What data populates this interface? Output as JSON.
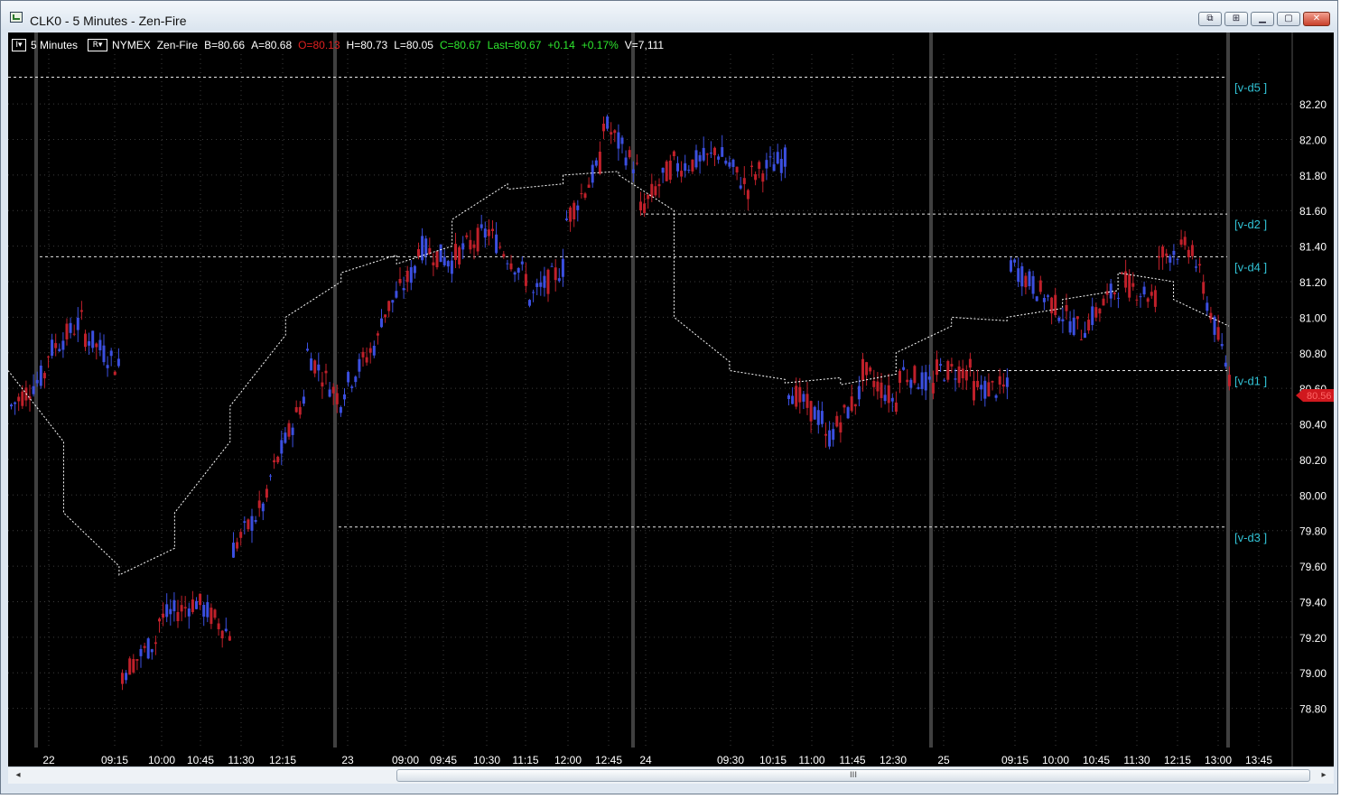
{
  "window": {
    "title": "CLK0 - 5 Minutes - Zen-Fire",
    "buttons": [
      "restore-down",
      "pin",
      "minimize",
      "maximize",
      "close"
    ]
  },
  "infobar": {
    "interval_btn": "I▾",
    "interval": "5 Minutes",
    "range_btn": "R▾",
    "exchange": "NYMEX",
    "feed": "Zen-Fire",
    "bid": "B=80.66",
    "ask": "A=80.68",
    "open": "O=80.13",
    "high": "H=80.73",
    "low": "L=80.05",
    "close": "C=80.67",
    "last": "Last=80.67",
    "change": "+0.14",
    "change_pct": "+0.17%",
    "volume": "V=7,111"
  },
  "colors": {
    "background": "#000000",
    "up_candle": "#3b4fe0",
    "down_candle": "#c0202a",
    "grid": "#3c3c3c",
    "text": "#ffffff",
    "level_label": "#31c3d6",
    "green_text": "#2ee82e",
    "red_text": "#e02020"
  },
  "scrollbar": {
    "left_arrow": "◂",
    "right_arrow": "▸",
    "grip": "III"
  },
  "chart_data": {
    "type": "candlestick",
    "symbol": "CLK0",
    "interval": "5 Minutes",
    "ylim": [
      78.6,
      82.5
    ],
    "y_ticks": [
      "82.20",
      "82.00",
      "81.80",
      "81.60",
      "81.40",
      "81.20",
      "81.00",
      "80.80",
      "80.60",
      "80.40",
      "80.20",
      "80.00",
      "79.80",
      "79.60",
      "79.40",
      "79.20",
      "79.00",
      "78.80"
    ],
    "last_price_marker": "80.56",
    "x_ticks": [
      "22",
      "09:15",
      "10:00",
      "10:45",
      "11:30",
      "12:15",
      "23",
      "09:00",
      "09:45",
      "10:30",
      "11:15",
      "12:00",
      "12:45",
      "24",
      "09:30",
      "10:15",
      "11:00",
      "11:45",
      "12:30",
      "25",
      "09:15",
      "10:00",
      "10:45",
      "11:30",
      "12:15",
      "13:00",
      "13:45"
    ],
    "sessions": [
      "22",
      "23",
      "24",
      "25"
    ],
    "levels": [
      {
        "label": "[v-d5 ]",
        "price": 82.35
      },
      {
        "label": "[v-d2 ]",
        "price": 81.58
      },
      {
        "label": "[v-d4 ]",
        "price": 81.34
      },
      {
        "label": "[v-d1 ]",
        "price": 80.7
      },
      {
        "label": "[v-d3 ]",
        "price": 79.82
      }
    ],
    "day_path": [
      [
        80.5,
        80.7
      ],
      [
        80.8,
        81.0
      ],
      [
        80.9,
        80.7
      ],
      [
        79.0,
        79.2
      ],
      [
        79.3,
        79.4
      ],
      [
        79.4,
        79.2
      ],
      [
        79.7,
        80.0
      ],
      [
        80.1,
        80.6
      ],
      [
        80.8,
        80.5
      ],
      [
        80.6,
        80.9
      ],
      [
        81.0,
        81.3
      ],
      [
        81.4,
        81.3
      ],
      [
        81.35,
        81.5
      ],
      [
        81.45,
        81.2
      ],
      [
        81.1,
        81.3
      ],
      [
        81.55,
        81.9
      ],
      [
        82.1,
        81.8
      ],
      [
        81.6,
        81.9
      ],
      [
        81.85,
        81.9
      ],
      [
        81.95,
        81.7
      ],
      [
        81.8,
        81.9
      ],
      [
        80.6,
        80.4
      ],
      [
        80.3,
        80.6
      ],
      [
        80.7,
        80.5
      ],
      [
        80.7,
        80.6
      ],
      [
        80.7,
        80.7
      ],
      [
        80.6,
        80.6
      ],
      [
        81.3,
        81.1
      ],
      [
        81.1,
        80.9
      ],
      [
        80.95,
        81.2
      ],
      [
        81.2,
        81.1
      ],
      [
        81.35,
        81.4
      ],
      [
        81.3,
        80.6
      ]
    ],
    "ma_path": [
      [
        80.7,
        80.3
      ],
      [
        79.9,
        79.6
      ],
      [
        79.55,
        79.7
      ],
      [
        79.9,
        80.3
      ],
      [
        80.5,
        80.9
      ],
      [
        81.0,
        81.2
      ],
      [
        81.25,
        81.35
      ],
      [
        81.3,
        81.4
      ],
      [
        81.55,
        81.75
      ],
      [
        81.72,
        81.75
      ],
      [
        81.8,
        81.82
      ],
      [
        81.8,
        81.6
      ],
      [
        81.0,
        80.75
      ],
      [
        80.7,
        80.65
      ],
      [
        80.63,
        80.66
      ],
      [
        80.62,
        80.68
      ],
      [
        80.8,
        80.95
      ],
      [
        81.0,
        80.98
      ],
      [
        81.0,
        81.05
      ],
      [
        81.1,
        81.15
      ],
      [
        81.25,
        81.2
      ],
      [
        81.1,
        80.95
      ]
    ]
  }
}
